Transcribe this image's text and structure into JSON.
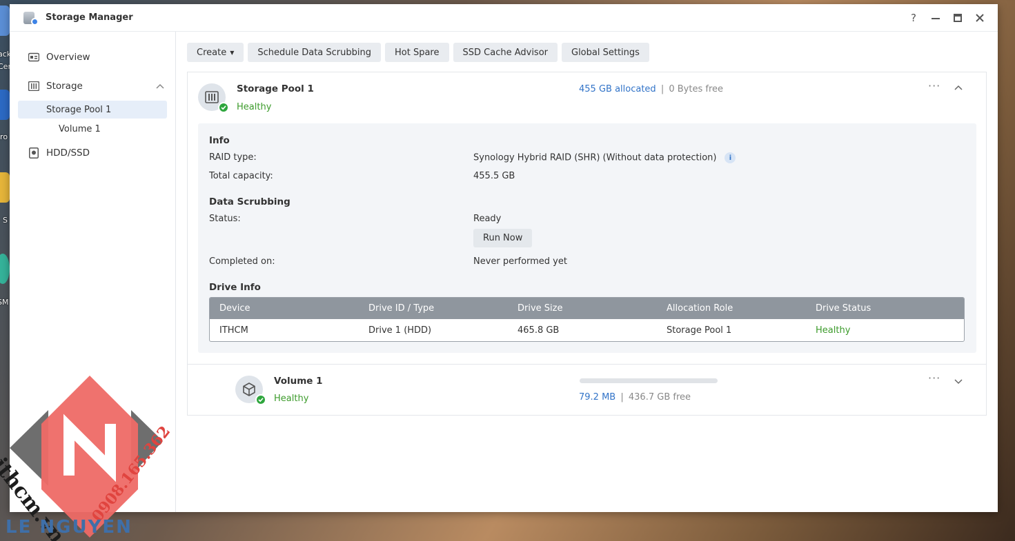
{
  "desktop": {
    "labels": [
      "ack",
      "Cer",
      "cro",
      "S",
      "SM"
    ]
  },
  "window": {
    "title": "Storage Manager",
    "controls": {
      "help": "?",
      "minimize": "minimize",
      "maximize": "maximize",
      "close": "close"
    }
  },
  "sidebar": {
    "overview": "Overview",
    "storage": "Storage",
    "storage_pool": "Storage Pool 1",
    "volume": "Volume 1",
    "hdd": "HDD/SSD"
  },
  "toolbar": {
    "create": "Create",
    "schedule": "Schedule Data Scrubbing",
    "hot_spare": "Hot Spare",
    "ssd_cache": "SSD Cache Advisor",
    "global": "Global Settings"
  },
  "pool": {
    "name": "Storage Pool 1",
    "status": "Healthy",
    "allocated": "455 GB allocated",
    "sep": "|",
    "free": "0 Bytes free",
    "info_title": "Info",
    "raid_label": "RAID type:",
    "raid_value": "Synology Hybrid RAID (SHR) (Without data protection)",
    "capacity_label": "Total capacity:",
    "capacity_value": "455.5 GB",
    "scrub_title": "Data Scrubbing",
    "scrub_status_label": "Status:",
    "scrub_status_value": "Ready",
    "run_now": "Run Now",
    "completed_label": "Completed on:",
    "completed_value": "Never performed yet",
    "drive_info_title": "Drive Info",
    "drive_table": {
      "headers": [
        "Device",
        "Drive ID / Type",
        "Drive Size",
        "Allocation Role",
        "Drive Status"
      ],
      "rows": [
        [
          "ITHCM",
          "Drive 1 (HDD)",
          "465.8 GB",
          "Storage Pool 1",
          "Healthy"
        ]
      ]
    }
  },
  "volume": {
    "name": "Volume 1",
    "status": "Healthy",
    "used": "79.2 MB",
    "sep": "|",
    "free": "436.7 GB free",
    "usage_fraction": 0.0002
  },
  "watermark": {
    "brand": "ithcm.vn",
    "phone": "0908.165.362",
    "name": "LE NGUYEN"
  },
  "colors": {
    "healthy": "#3c9b2b",
    "link": "#3173c8",
    "accent_red": "#ee5a55"
  }
}
